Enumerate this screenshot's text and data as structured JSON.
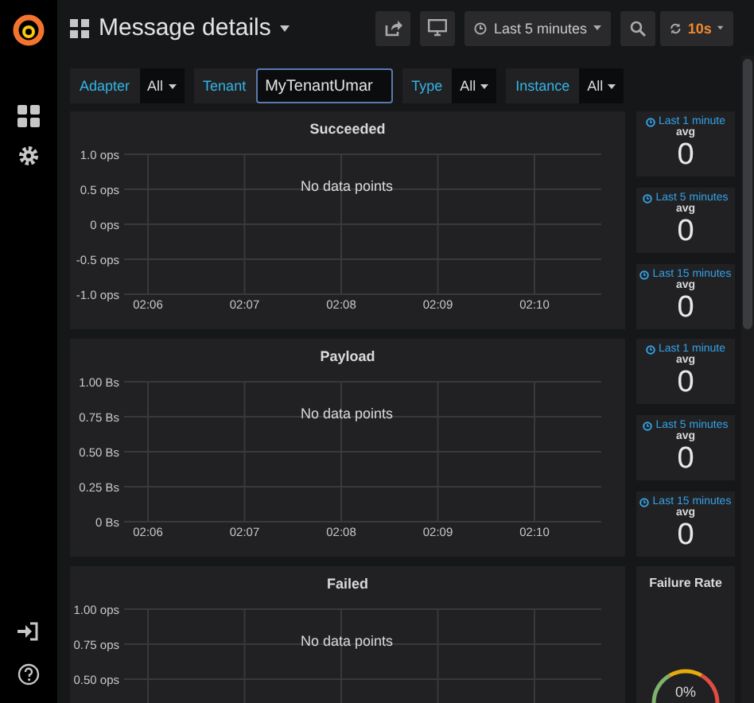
{
  "topbar": {
    "title": "Message details",
    "time_range": "Last 5 minutes",
    "refresh": "10s"
  },
  "variables": [
    {
      "label": "Adapter",
      "kind": "select",
      "value": "All"
    },
    {
      "label": "Tenant",
      "kind": "text",
      "value": "MyTenantUmar"
    },
    {
      "label": "Type",
      "kind": "select",
      "value": "All"
    },
    {
      "label": "Instance",
      "kind": "select",
      "value": "All"
    }
  ],
  "graphs": [
    {
      "title": "Succeeded",
      "message": "No data points",
      "chart_data": {
        "type": "line",
        "grid": true,
        "categories": [
          "02:06",
          "02:07",
          "02:08",
          "02:09",
          "02:10"
        ],
        "ylim": [
          -1,
          1
        ],
        "yticks": [
          {
            "value": 1,
            "label": "1.0 ops"
          },
          {
            "value": 0.5,
            "label": "0.5 ops"
          },
          {
            "value": 0,
            "label": "0 ops"
          },
          {
            "value": -0.5,
            "label": "-0.5 ops"
          },
          {
            "value": -1,
            "label": "-1.0 ops"
          }
        ]
      }
    },
    {
      "title": "Payload",
      "message": "No data points",
      "chart_data": {
        "type": "line",
        "grid": true,
        "categories": [
          "02:06",
          "02:07",
          "02:08",
          "02:09",
          "02:10"
        ],
        "ylim": [
          0,
          1
        ],
        "yticks": [
          {
            "value": 1,
            "label": "1.00 Bs"
          },
          {
            "value": 0.75,
            "label": "0.75 Bs"
          },
          {
            "value": 0.5,
            "label": "0.50 Bs"
          },
          {
            "value": 0.25,
            "label": "0.25 Bs"
          },
          {
            "value": 0,
            "label": "0 Bs"
          }
        ]
      }
    },
    {
      "title": "Failed",
      "message": "No data points",
      "chart_data": {
        "type": "line",
        "grid": true,
        "categories": [
          null,
          null,
          null,
          null,
          null
        ],
        "ylim": [
          0.5,
          1
        ],
        "yticks": [
          {
            "value": 1,
            "label": "1.00 ops"
          },
          {
            "value": 0.75,
            "label": "0.75 ops"
          },
          {
            "value": 0.5,
            "label": "0.50 ops"
          }
        ]
      }
    }
  ],
  "stats": [
    {
      "period": "Last 1 minute",
      "reducer": "avg",
      "value": "0"
    },
    {
      "period": "Last 5 minutes",
      "reducer": "avg",
      "value": "0"
    },
    {
      "period": "Last 15 minutes",
      "reducer": "avg",
      "value": "0"
    },
    {
      "period": "Last 1 minute",
      "reducer": "avg",
      "value": "0"
    },
    {
      "period": "Last 5 minutes",
      "reducer": "avg",
      "value": "0"
    },
    {
      "period": "Last 15 minutes",
      "reducer": "avg",
      "value": "0"
    }
  ],
  "gauge": {
    "title": "Failure Rate",
    "value": "0%"
  }
}
